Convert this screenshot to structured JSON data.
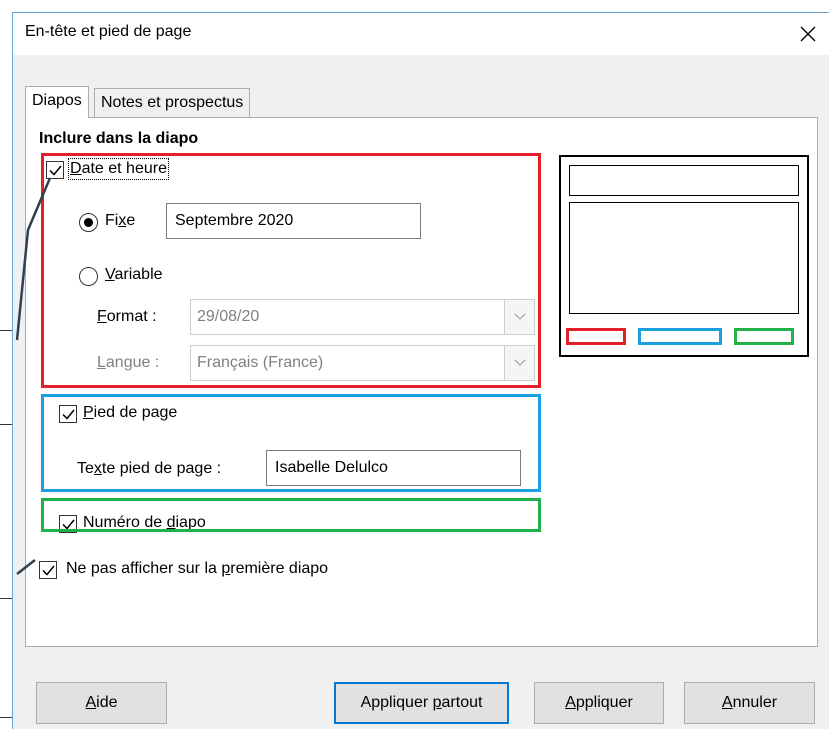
{
  "dialog": {
    "title": "En-tête et pied de page"
  },
  "tabs": [
    {
      "label": "Diapos",
      "active": true
    },
    {
      "label": "Notes et prospectus",
      "active": false
    }
  ],
  "section": {
    "title": "Inclure dans la diapo"
  },
  "date_time": {
    "checked": true,
    "label_pre": "",
    "label_u": "D",
    "label_post": "ate et heure",
    "fixed": {
      "selected": true,
      "label_pre": "Fi",
      "label_u": "x",
      "label_post": "e",
      "value": "Septembre 2020"
    },
    "variable": {
      "selected": false,
      "label_u": "V",
      "label_post": "ariable"
    },
    "format": {
      "label_u": "F",
      "label_post": "ormat :",
      "value": "29/08/20"
    },
    "language": {
      "label_u": "L",
      "label_post": "angue :",
      "value": "Français (France)"
    }
  },
  "footer": {
    "checked": true,
    "label_u": "P",
    "label_post": "ied de page",
    "text_label_pre": "Te",
    "text_label_u": "x",
    "text_label_post": "te pied de page :",
    "text_value": "Isabelle Delulco"
  },
  "slide_number": {
    "checked": true,
    "label_pre": "Numéro de ",
    "label_u": "d",
    "label_post": "iapo"
  },
  "not_first": {
    "checked": true,
    "label_pre": "Ne pas afficher sur la ",
    "label_u": "p",
    "label_post": "remière diapo"
  },
  "buttons": {
    "help_u": "A",
    "help_post": "ide",
    "apply_all_pre": "Appliquer ",
    "apply_all_u": "p",
    "apply_all_post": "artout",
    "apply_u": "A",
    "apply_post": "ppliquer",
    "cancel_u": "A",
    "cancel_post": "nnuler"
  },
  "colors": {
    "date_frame": "#e3202a",
    "footer_frame": "#1ba1e2",
    "number_frame": "#22b04a",
    "default_button": "#0078d7"
  }
}
